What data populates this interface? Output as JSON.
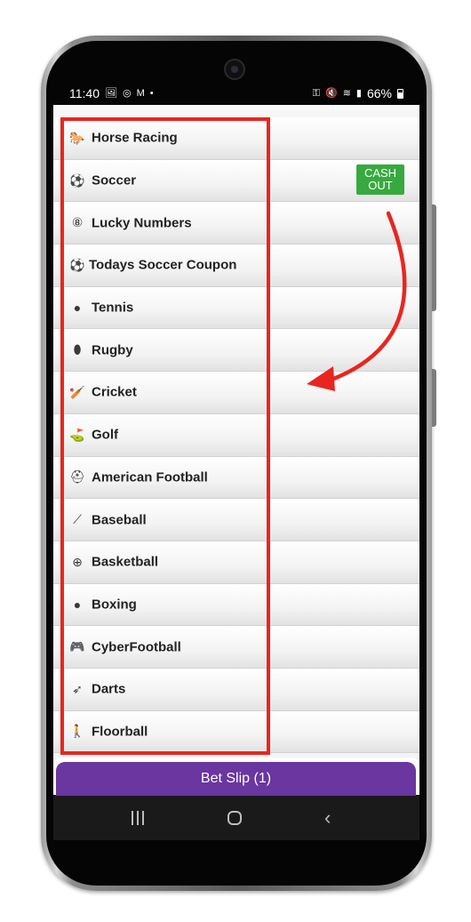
{
  "status_bar": {
    "time": "11:40",
    "left_icons": [
      "gallery-icon",
      "whatsapp-icon",
      "gmail-icon",
      "dot-icon"
    ],
    "right_icons": [
      "key-icon",
      "mute-icon",
      "wifi-icon",
      "signal-icon"
    ],
    "battery": "66%"
  },
  "sports": [
    {
      "label": "Horse Racing",
      "icon": "horse-icon",
      "glyph": "🐎"
    },
    {
      "label": "Soccer",
      "icon": "soccer-ball-icon",
      "glyph": "⚽"
    },
    {
      "label": "Lucky Numbers",
      "icon": "eight-ball-icon",
      "glyph": "⑧"
    },
    {
      "label": "Todays Soccer Coupon",
      "icon": "soccer-ball-icon",
      "glyph": "⚽"
    },
    {
      "label": "Tennis",
      "icon": "tennis-ball-icon",
      "glyph": "●"
    },
    {
      "label": "Rugby",
      "icon": "rugby-ball-icon",
      "glyph": "⬮"
    },
    {
      "label": "Cricket",
      "icon": "cricket-player-icon",
      "glyph": "🏏"
    },
    {
      "label": "Golf",
      "icon": "golf-bag-icon",
      "glyph": "⛳"
    },
    {
      "label": "American Football",
      "icon": "football-helmet-icon",
      "glyph": "⛑"
    },
    {
      "label": "Baseball",
      "icon": "baseball-bat-icon",
      "glyph": "⟋"
    },
    {
      "label": "Basketball",
      "icon": "basketball-icon",
      "glyph": "⊕"
    },
    {
      "label": "Boxing",
      "icon": "boxing-glove-icon",
      "glyph": "●"
    },
    {
      "label": "CyberFootball",
      "icon": "gamepad-icon",
      "glyph": "🎮"
    },
    {
      "label": "Darts",
      "icon": "dart-icon",
      "glyph": "➶"
    },
    {
      "label": "Floorball",
      "icon": "floorball-player-icon",
      "glyph": "🚶"
    }
  ],
  "cash_out": "CASH OUT",
  "bet_slip": "Bet Slip (1)",
  "nav": {
    "recent": "recent-apps-icon",
    "home": "home-icon",
    "back": "back-icon"
  },
  "colors": {
    "highlight": "#e8261f",
    "cash_out": "#37a93f",
    "bet_slip": "#6a36a0"
  }
}
